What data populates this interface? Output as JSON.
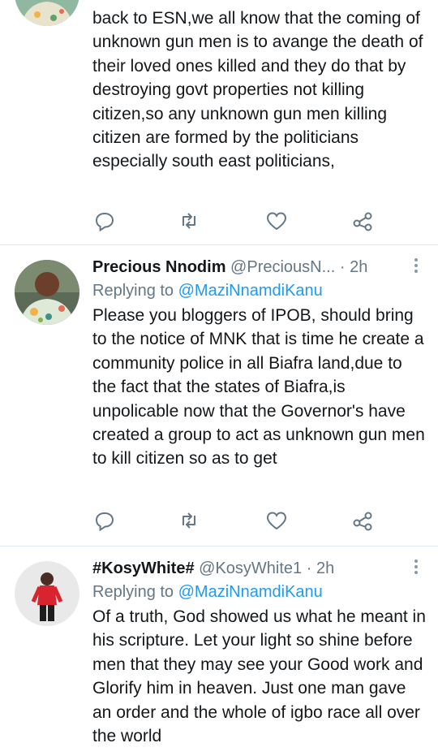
{
  "tweets": [
    {
      "name": "",
      "handle": "",
      "time": "",
      "replying_prefix": "",
      "replying_to": "",
      "text": "back to ESN,we all know that the coming of unknown gun men is to avange the death of their loved ones killed and they do that by destroying govt properties not killing citizen,so any unknown gun men killing citizen are formed by the politicians especially south east politicians,"
    },
    {
      "name": "Precious Nnodim",
      "handle": "@PreciousN...",
      "time": "2h",
      "replying_prefix": "Replying to",
      "replying_to": "@MaziNnamdiKanu",
      "text": "Please you bloggers of IPOB, should bring to the notice of MNK that is time he create a community police in all Biafra land,due to the fact that the states of Biafra,is unpolicable now that the Governor's have created a group to act as unknown gun men to kill citizen so as to get"
    },
    {
      "name": "#KosyWhite#",
      "handle": "@KosyWhite1",
      "time": "2h",
      "replying_prefix": "Replying to",
      "replying_to": "@MaziNnamdiKanu",
      "text": "Of a truth, God showed us what he meant in his scripture. Let your light so shine before men that they may see your Good work and Glorify him in heaven. Just one man gave an order and the whole of igbo race all over the world"
    }
  ],
  "separator": "·",
  "icons": [
    "reply-icon",
    "retweet-icon",
    "like-icon",
    "share-icon",
    "more-icon"
  ],
  "colors": {
    "link": "#1d9bf0",
    "muted": "#657786",
    "text": "#14171a",
    "icon": "#657786"
  }
}
